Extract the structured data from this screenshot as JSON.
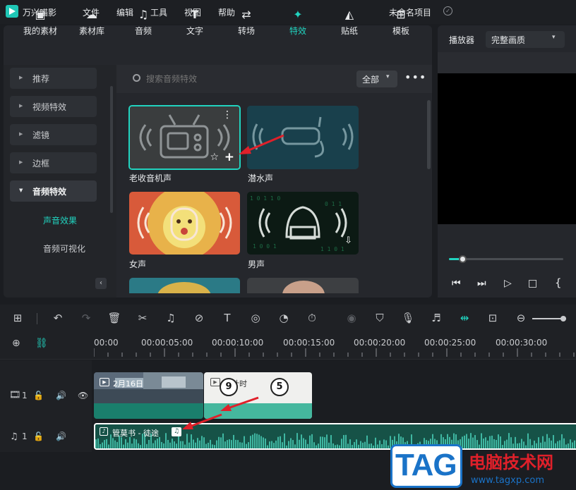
{
  "app": {
    "name": "万兴喵影",
    "project_name": "未命名项目"
  },
  "menu": [
    "文件",
    "编辑",
    "工具",
    "视图",
    "帮助"
  ],
  "tabs": [
    {
      "label": "我的素材",
      "icon": "image-icon"
    },
    {
      "label": "素材库",
      "icon": "cloud-icon"
    },
    {
      "label": "音频",
      "icon": "music-icon"
    },
    {
      "label": "文字",
      "icon": "text-icon"
    },
    {
      "label": "转场",
      "icon": "transition-icon"
    },
    {
      "label": "特效",
      "icon": "effects-icon"
    },
    {
      "label": "贴纸",
      "icon": "sticker-icon"
    },
    {
      "label": "模板",
      "icon": "template-icon"
    }
  ],
  "categories": [
    {
      "label": "推荐"
    },
    {
      "label": "视频特效"
    },
    {
      "label": "滤镜"
    },
    {
      "label": "边框"
    },
    {
      "label": "音频特效"
    }
  ],
  "subcategories": [
    {
      "label": "声音效果"
    },
    {
      "label": "音频可视化"
    }
  ],
  "search": {
    "placeholder": "搜索音频特效",
    "filter": "全部"
  },
  "effects": [
    {
      "label": "老收音机声"
    },
    {
      "label": "潜水声"
    },
    {
      "label": "女声"
    },
    {
      "label": "男声"
    }
  ],
  "player": {
    "label": "播放器",
    "quality": "完整画质"
  },
  "timeline": {
    "ticks": [
      "00:00",
      "00:00:05:00",
      "00:00:10:00",
      "00:00:15:00",
      "00:00:20:00",
      "00:00:25:00",
      "00:00:30:00"
    ],
    "clips": {
      "video1": "2月16日",
      "video2": "倒计时",
      "audio": "管莫书 - 徒途"
    },
    "track_video": "1",
    "track_audio": "1"
  },
  "watermark": {
    "tag": "TAG",
    "site": "电脑技术网",
    "url": "www.tagxp.com"
  },
  "colors": {
    "accent": "#21d3bf",
    "audio_wave": "#1f9d85",
    "red_arrow": "#e0202a"
  }
}
